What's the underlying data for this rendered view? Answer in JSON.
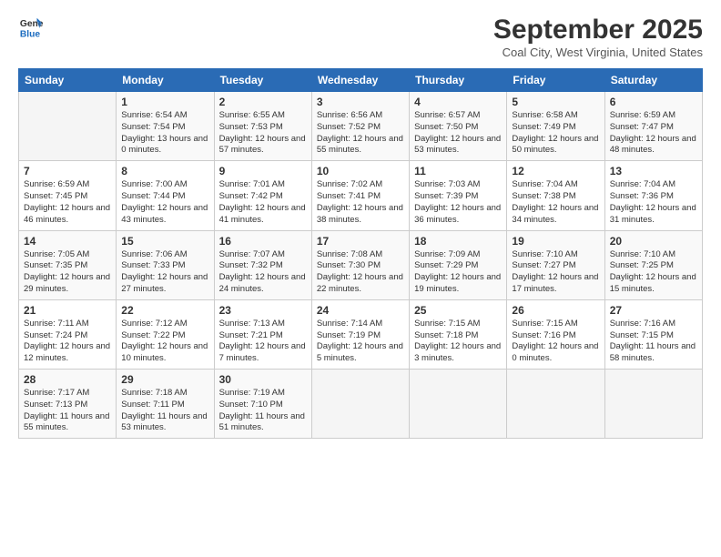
{
  "header": {
    "logo_general": "General",
    "logo_blue": "Blue",
    "month_title": "September 2025",
    "location": "Coal City, West Virginia, United States"
  },
  "weekdays": [
    "Sunday",
    "Monday",
    "Tuesday",
    "Wednesday",
    "Thursday",
    "Friday",
    "Saturday"
  ],
  "weeks": [
    [
      {
        "day": "",
        "sunrise": "",
        "sunset": "",
        "daylight": ""
      },
      {
        "day": "1",
        "sunrise": "Sunrise: 6:54 AM",
        "sunset": "Sunset: 7:54 PM",
        "daylight": "Daylight: 13 hours and 0 minutes."
      },
      {
        "day": "2",
        "sunrise": "Sunrise: 6:55 AM",
        "sunset": "Sunset: 7:53 PM",
        "daylight": "Daylight: 12 hours and 57 minutes."
      },
      {
        "day": "3",
        "sunrise": "Sunrise: 6:56 AM",
        "sunset": "Sunset: 7:52 PM",
        "daylight": "Daylight: 12 hours and 55 minutes."
      },
      {
        "day": "4",
        "sunrise": "Sunrise: 6:57 AM",
        "sunset": "Sunset: 7:50 PM",
        "daylight": "Daylight: 12 hours and 53 minutes."
      },
      {
        "day": "5",
        "sunrise": "Sunrise: 6:58 AM",
        "sunset": "Sunset: 7:49 PM",
        "daylight": "Daylight: 12 hours and 50 minutes."
      },
      {
        "day": "6",
        "sunrise": "Sunrise: 6:59 AM",
        "sunset": "Sunset: 7:47 PM",
        "daylight": "Daylight: 12 hours and 48 minutes."
      }
    ],
    [
      {
        "day": "7",
        "sunrise": "Sunrise: 6:59 AM",
        "sunset": "Sunset: 7:45 PM",
        "daylight": "Daylight: 12 hours and 46 minutes."
      },
      {
        "day": "8",
        "sunrise": "Sunrise: 7:00 AM",
        "sunset": "Sunset: 7:44 PM",
        "daylight": "Daylight: 12 hours and 43 minutes."
      },
      {
        "day": "9",
        "sunrise": "Sunrise: 7:01 AM",
        "sunset": "Sunset: 7:42 PM",
        "daylight": "Daylight: 12 hours and 41 minutes."
      },
      {
        "day": "10",
        "sunrise": "Sunrise: 7:02 AM",
        "sunset": "Sunset: 7:41 PM",
        "daylight": "Daylight: 12 hours and 38 minutes."
      },
      {
        "day": "11",
        "sunrise": "Sunrise: 7:03 AM",
        "sunset": "Sunset: 7:39 PM",
        "daylight": "Daylight: 12 hours and 36 minutes."
      },
      {
        "day": "12",
        "sunrise": "Sunrise: 7:04 AM",
        "sunset": "Sunset: 7:38 PM",
        "daylight": "Daylight: 12 hours and 34 minutes."
      },
      {
        "day": "13",
        "sunrise": "Sunrise: 7:04 AM",
        "sunset": "Sunset: 7:36 PM",
        "daylight": "Daylight: 12 hours and 31 minutes."
      }
    ],
    [
      {
        "day": "14",
        "sunrise": "Sunrise: 7:05 AM",
        "sunset": "Sunset: 7:35 PM",
        "daylight": "Daylight: 12 hours and 29 minutes."
      },
      {
        "day": "15",
        "sunrise": "Sunrise: 7:06 AM",
        "sunset": "Sunset: 7:33 PM",
        "daylight": "Daylight: 12 hours and 27 minutes."
      },
      {
        "day": "16",
        "sunrise": "Sunrise: 7:07 AM",
        "sunset": "Sunset: 7:32 PM",
        "daylight": "Daylight: 12 hours and 24 minutes."
      },
      {
        "day": "17",
        "sunrise": "Sunrise: 7:08 AM",
        "sunset": "Sunset: 7:30 PM",
        "daylight": "Daylight: 12 hours and 22 minutes."
      },
      {
        "day": "18",
        "sunrise": "Sunrise: 7:09 AM",
        "sunset": "Sunset: 7:29 PM",
        "daylight": "Daylight: 12 hours and 19 minutes."
      },
      {
        "day": "19",
        "sunrise": "Sunrise: 7:10 AM",
        "sunset": "Sunset: 7:27 PM",
        "daylight": "Daylight: 12 hours and 17 minutes."
      },
      {
        "day": "20",
        "sunrise": "Sunrise: 7:10 AM",
        "sunset": "Sunset: 7:25 PM",
        "daylight": "Daylight: 12 hours and 15 minutes."
      }
    ],
    [
      {
        "day": "21",
        "sunrise": "Sunrise: 7:11 AM",
        "sunset": "Sunset: 7:24 PM",
        "daylight": "Daylight: 12 hours and 12 minutes."
      },
      {
        "day": "22",
        "sunrise": "Sunrise: 7:12 AM",
        "sunset": "Sunset: 7:22 PM",
        "daylight": "Daylight: 12 hours and 10 minutes."
      },
      {
        "day": "23",
        "sunrise": "Sunrise: 7:13 AM",
        "sunset": "Sunset: 7:21 PM",
        "daylight": "Daylight: 12 hours and 7 minutes."
      },
      {
        "day": "24",
        "sunrise": "Sunrise: 7:14 AM",
        "sunset": "Sunset: 7:19 PM",
        "daylight": "Daylight: 12 hours and 5 minutes."
      },
      {
        "day": "25",
        "sunrise": "Sunrise: 7:15 AM",
        "sunset": "Sunset: 7:18 PM",
        "daylight": "Daylight: 12 hours and 3 minutes."
      },
      {
        "day": "26",
        "sunrise": "Sunrise: 7:15 AM",
        "sunset": "Sunset: 7:16 PM",
        "daylight": "Daylight: 12 hours and 0 minutes."
      },
      {
        "day": "27",
        "sunrise": "Sunrise: 7:16 AM",
        "sunset": "Sunset: 7:15 PM",
        "daylight": "Daylight: 11 hours and 58 minutes."
      }
    ],
    [
      {
        "day": "28",
        "sunrise": "Sunrise: 7:17 AM",
        "sunset": "Sunset: 7:13 PM",
        "daylight": "Daylight: 11 hours and 55 minutes."
      },
      {
        "day": "29",
        "sunrise": "Sunrise: 7:18 AM",
        "sunset": "Sunset: 7:11 PM",
        "daylight": "Daylight: 11 hours and 53 minutes."
      },
      {
        "day": "30",
        "sunrise": "Sunrise: 7:19 AM",
        "sunset": "Sunset: 7:10 PM",
        "daylight": "Daylight: 11 hours and 51 minutes."
      },
      {
        "day": "",
        "sunrise": "",
        "sunset": "",
        "daylight": ""
      },
      {
        "day": "",
        "sunrise": "",
        "sunset": "",
        "daylight": ""
      },
      {
        "day": "",
        "sunrise": "",
        "sunset": "",
        "daylight": ""
      },
      {
        "day": "",
        "sunrise": "",
        "sunset": "",
        "daylight": ""
      }
    ]
  ]
}
